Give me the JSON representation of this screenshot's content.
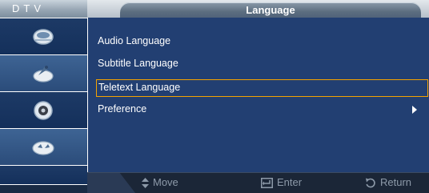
{
  "header": {
    "source_label": "DTV",
    "title": "Language"
  },
  "sidebar": {
    "icons": [
      {
        "icon": "antenna-dish-icon"
      },
      {
        "icon": "satellite-icon"
      },
      {
        "icon": "settings-gear-icon"
      },
      {
        "icon": "input-plug-icon"
      }
    ]
  },
  "menu": {
    "items": [
      {
        "label": "Audio Language",
        "selected": false,
        "has_submenu": false
      },
      {
        "label": "Subtitle Language",
        "selected": false,
        "has_submenu": false
      },
      {
        "label": "Teletext Language",
        "selected": true,
        "has_submenu": false
      },
      {
        "label": "Preference",
        "selected": false,
        "has_submenu": true
      }
    ]
  },
  "footer": {
    "move_label": "Move",
    "enter_label": "Enter",
    "return_label": "Return"
  },
  "colors": {
    "panel": "#223f72",
    "selection_border": "#f5a300",
    "footer_text": "#8d9aa9"
  }
}
